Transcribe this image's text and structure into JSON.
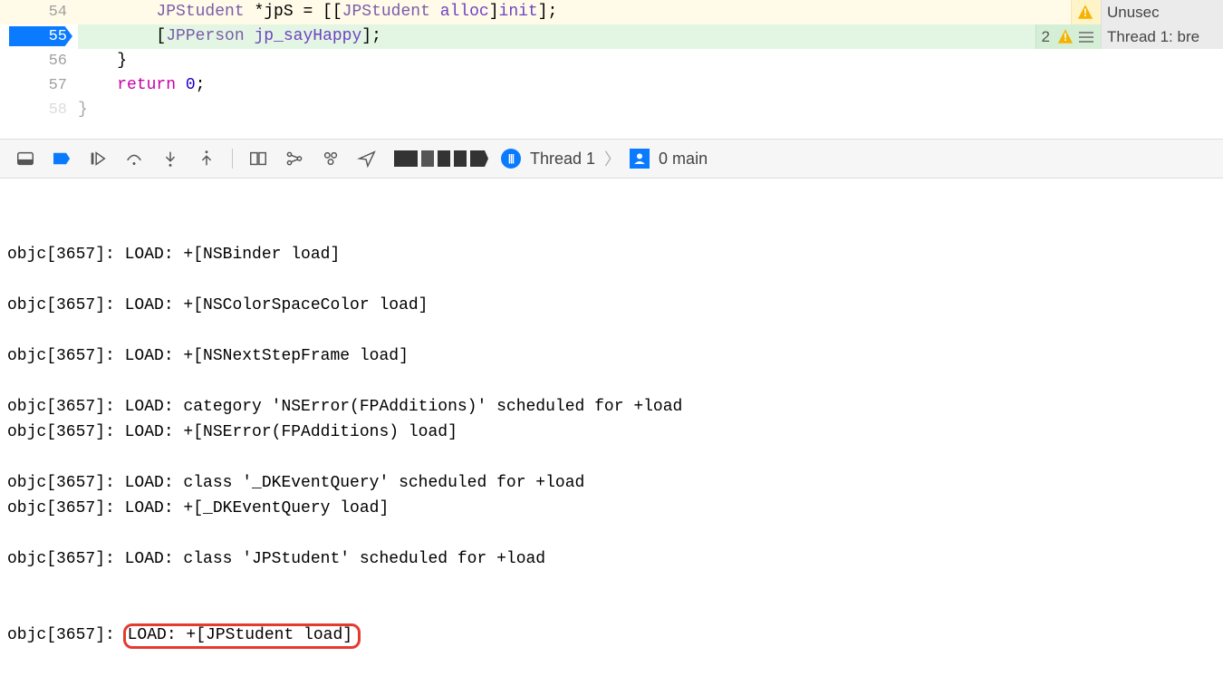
{
  "code": {
    "lines": [
      {
        "num": "54",
        "indent": "        ",
        "segments": [
          {
            "t": "JPStudent",
            "cls": "tok-type"
          },
          {
            "t": " *jpS = [["
          },
          {
            "t": "JPStudent",
            "cls": "tok-type"
          },
          {
            "t": " "
          },
          {
            "t": "alloc",
            "cls": "tok-mtd"
          },
          {
            "t": "]"
          },
          {
            "t": "init",
            "cls": "tok-mtd"
          },
          {
            "t": "];"
          }
        ],
        "row_style": "hl-warn",
        "gutter_style": "hl-warn"
      },
      {
        "num": "55",
        "indent": "        ",
        "segments": [
          {
            "t": "["
          },
          {
            "t": "JPPerson",
            "cls": "tok-type"
          },
          {
            "t": " "
          },
          {
            "t": "jp_sayHappy",
            "cls": "tok-mtd"
          },
          {
            "t": "];"
          }
        ],
        "row_style": "hl-current",
        "gutter_style": "",
        "breakpoint": true
      },
      {
        "num": "56",
        "indent": "    ",
        "segments": [
          {
            "t": "}"
          }
        ]
      },
      {
        "num": "57",
        "indent": "    ",
        "segments": [
          {
            "t": "return",
            "cls": "tok-kw"
          },
          {
            "t": " "
          },
          {
            "t": "0",
            "cls": "tok-num"
          },
          {
            "t": ";"
          }
        ]
      },
      {
        "num": "58",
        "indent": "",
        "segments": [
          {
            "t": "}"
          }
        ],
        "faded": true
      }
    ]
  },
  "issues": {
    "row0": {
      "text": "Unusec",
      "kind": "warn"
    },
    "row1_left": {
      "count": "2"
    },
    "row1_right": {
      "text": "Thread 1: bre"
    }
  },
  "toolbar": {
    "thread_label": "Thread 1",
    "frame_label": "0 main"
  },
  "console_lines": [
    "objc[3657]: LOAD: +[NSBinder load]",
    "",
    "objc[3657]: LOAD: +[NSColorSpaceColor load]",
    "",
    "objc[3657]: LOAD: +[NSNextStepFrame load]",
    "",
    "objc[3657]: LOAD: category 'NSError(FPAdditions)' scheduled for +load",
    "objc[3657]: LOAD: +[NSError(FPAdditions) load]",
    "",
    "objc[3657]: LOAD: class '_DKEventQuery' scheduled for +load",
    "objc[3657]: LOAD: +[_DKEventQuery load]",
    "",
    "objc[3657]: LOAD: class 'JPStudent' scheduled for +load"
  ],
  "console_last_prefix": "objc[3657]: ",
  "console_last_highlight": "LOAD: +[JPStudent load]"
}
